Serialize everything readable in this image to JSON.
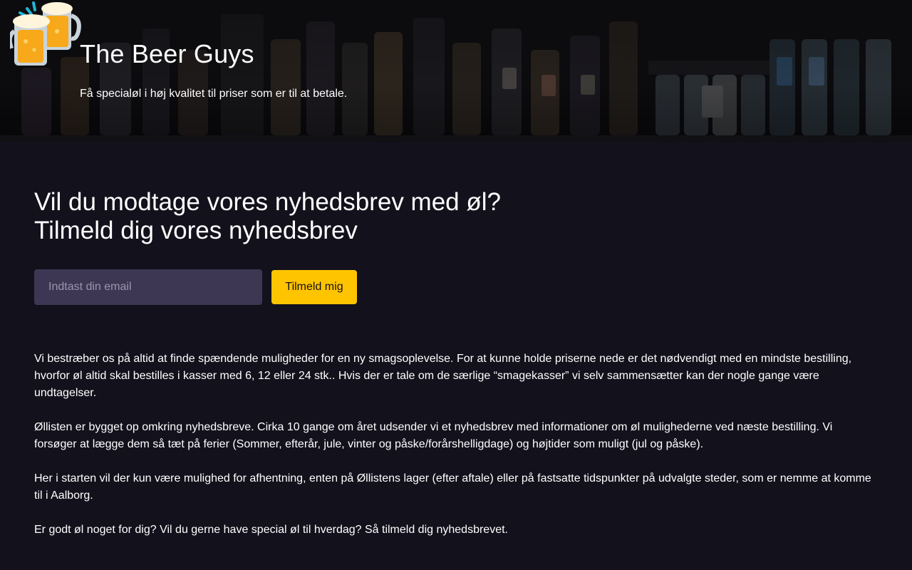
{
  "header": {
    "title": "The Beer Guys",
    "tagline": "Få specialøl i høj kvalitet til priser som er til at betale."
  },
  "newsletter": {
    "headline_line1": "Vil du modtage vores nyhedsbrev med øl?",
    "headline_line2": "Tilmeld dig vores nyhedsbrev",
    "email_placeholder": "Indtast din email",
    "email_value": "",
    "button_label": "Tilmeld mig"
  },
  "content": {
    "paragraphs": [
      "Vi bestræber os på altid at finde spændende muligheder for en ny smagsoplevelse. For at kunne holde priserne nede er det nødvendigt med en mindste bestilling, hvorfor øl altid skal bestilles i kasser med 6, 12 eller 24 stk.. Hvis der er tale om de særlige “smagekasser” vi selv sammensætter kan der nogle gange være undtagelser.",
      "Øllisten er bygget op omkring nyhedsbreve. Cirka 10 gange om året udsender vi et nyhedsbrev med informationer om øl mulighederne ved næste bestilling. Vi forsøger at lægge dem så tæt på ferier (Sommer, efterår, jule, vinter og påske/forårshelligdage) og højtider som muligt (jul og påske).",
      "Her i starten vil der kun være mulighed for afhentning, enten på Øllistens lager (efter aftale) eller på fastsatte tidspunkter på udvalgte steder, som er nemme at komme til i Aalborg.",
      "Er godt øl noget for dig? Vil du gerne have special øl til hverdag? Så tilmeld dig nyhedsbrevet."
    ]
  },
  "colors": {
    "page_background": "#13111c",
    "input_background": "#3d3754",
    "button_background": "#ffc400",
    "text": "#ffffff"
  },
  "icons": {
    "logo": "beer-mugs-cheers-icon",
    "hero_image": "beer-bottles-shelf-photo"
  }
}
